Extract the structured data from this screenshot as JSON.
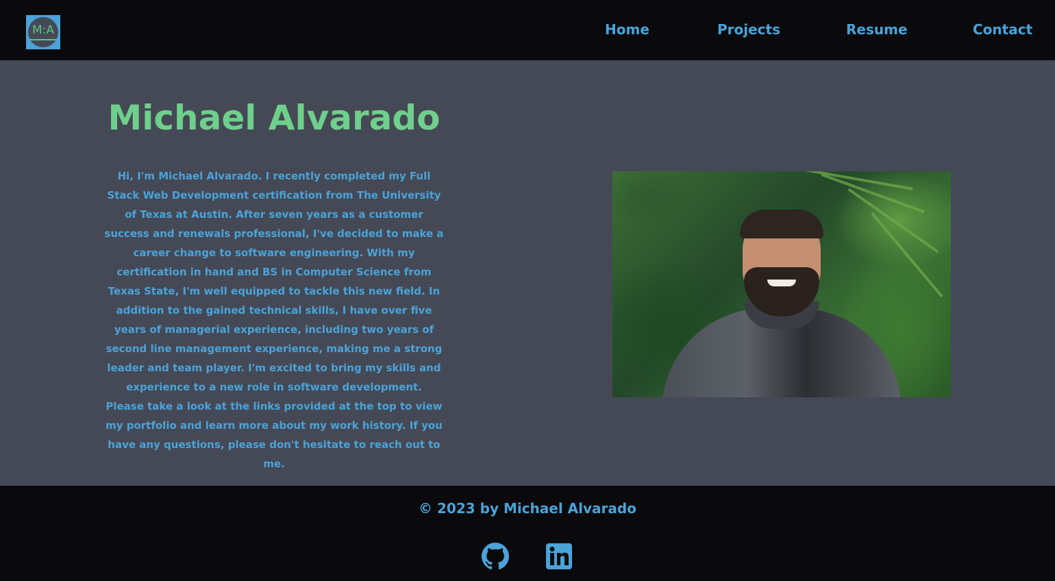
{
  "header": {
    "logo_text": "M:A",
    "nav": [
      {
        "label": "Home"
      },
      {
        "label": "Projects"
      },
      {
        "label": "Resume"
      },
      {
        "label": "Contact"
      }
    ]
  },
  "main": {
    "title": "Michael Alvarado",
    "bio_paragraph_1": "Hi, I'm Michael Alvarado. I recently completed my Full Stack Web Development certification from The University of Texas at Austin. After seven years as a customer success and renewals professional, I've decided to make a career change to software engineering. With my certification in hand and BS in Computer Science from Texas State, I'm well equipped to tackle this new field. In addition to the gained technical skills, I have over five years of managerial experience, including two years of second line management experience, making me a strong leader and team player. I'm excited to bring my skills and experience to a new role in software development.",
    "bio_paragraph_2": "Please take a look at the links provided at the top to view my portfolio and learn more about my work history. If you have any questions, please don't hesitate to reach out to me."
  },
  "footer": {
    "copyright": "© 2023 by Michael Alvarado",
    "social_icons": [
      "github-icon",
      "linkedin-icon"
    ]
  },
  "colors": {
    "header_bg": "#0a0a0c",
    "main_bg": "#454955",
    "accent_blue": "#4aa3d9",
    "accent_green": "#6fcf8c"
  }
}
